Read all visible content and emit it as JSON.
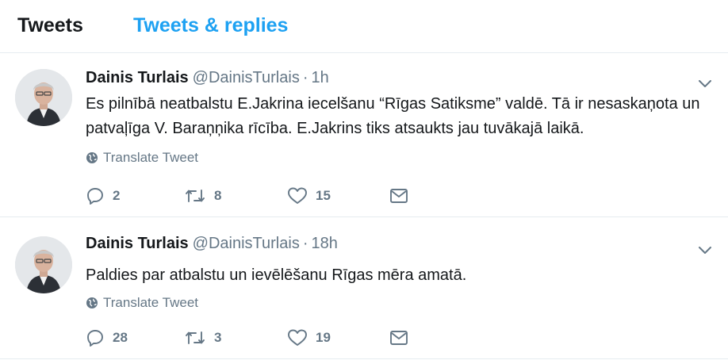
{
  "tabs": {
    "active": "Tweets",
    "inactive": "Tweets & replies"
  },
  "colors": {
    "link_blue": "#1da1f2",
    "muted_gray": "#657786",
    "divider": "#e6ecf0"
  },
  "tweets": [
    {
      "author_name": "Dainis Turlais",
      "handle": "@DainisTurlais",
      "separator": "·",
      "time": "1h",
      "text": "Es pilnībā neatbalstu E.Jakrina iecelšanu “Rīgas Satiksme” valdē. Tā ir nesaskaņota un patvaļīga V. Baraņņika rīcība. E.Jakrins tiks atsaukts jau tuvākajā laikā.",
      "translate_label": "Translate Tweet",
      "replies": "2",
      "retweets": "8",
      "likes": "15"
    },
    {
      "author_name": "Dainis Turlais",
      "handle": "@DainisTurlais",
      "separator": "·",
      "time": "18h",
      "text": "Paldies par atbalstu un ievēlēšanu Rīgas mēra amatā.",
      "translate_label": "Translate Tweet",
      "replies": "28",
      "retweets": "3",
      "likes": "19"
    }
  ],
  "icons": [
    "globe-icon",
    "reply-icon",
    "retweet-icon",
    "like-icon",
    "direct-message-icon",
    "chevron-down-icon"
  ]
}
